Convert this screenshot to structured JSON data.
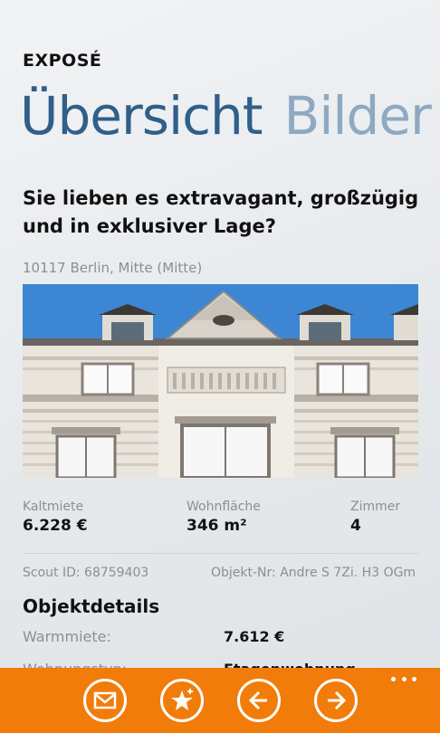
{
  "app": {
    "title": "EXPOSÉ"
  },
  "pivot": {
    "items": [
      {
        "label": "Übersicht"
      },
      {
        "label": "Bilder"
      }
    ]
  },
  "listing": {
    "headline": "Sie lieben es extravagant, großzügig und in exklusiver Lage?",
    "address": "10117 Berlin, Mitte (Mitte)",
    "photo_alt": "building-facade-photo"
  },
  "facts": [
    {
      "label": "Kaltmiete",
      "value": "6.228 €"
    },
    {
      "label": "Wohnfläche",
      "value": "346 m²"
    },
    {
      "label": "Zimmer",
      "value": "4"
    }
  ],
  "ids": {
    "scout_id": "Scout ID: 68759403",
    "objekt_nr": "Objekt-Nr: Andre S 7Zi. H3 OGm"
  },
  "details": {
    "title": "Objektdetails",
    "rows": [
      {
        "label": "Warmmiete:",
        "value": "7.612 €"
      },
      {
        "label": "Wohnungstyp:",
        "value": "Etagenwohnung"
      }
    ]
  },
  "appbar": {
    "buttons": [
      {
        "icon": "mail-icon"
      },
      {
        "icon": "favorite-star-icon"
      },
      {
        "icon": "back-arrow-icon"
      },
      {
        "icon": "forward-arrow-icon"
      }
    ],
    "more_icon": "more-icon"
  },
  "colors": {
    "accent": "#f27c09",
    "pivot_active": "#2f5f8a",
    "pivot_inactive": "#8ea9c1"
  }
}
